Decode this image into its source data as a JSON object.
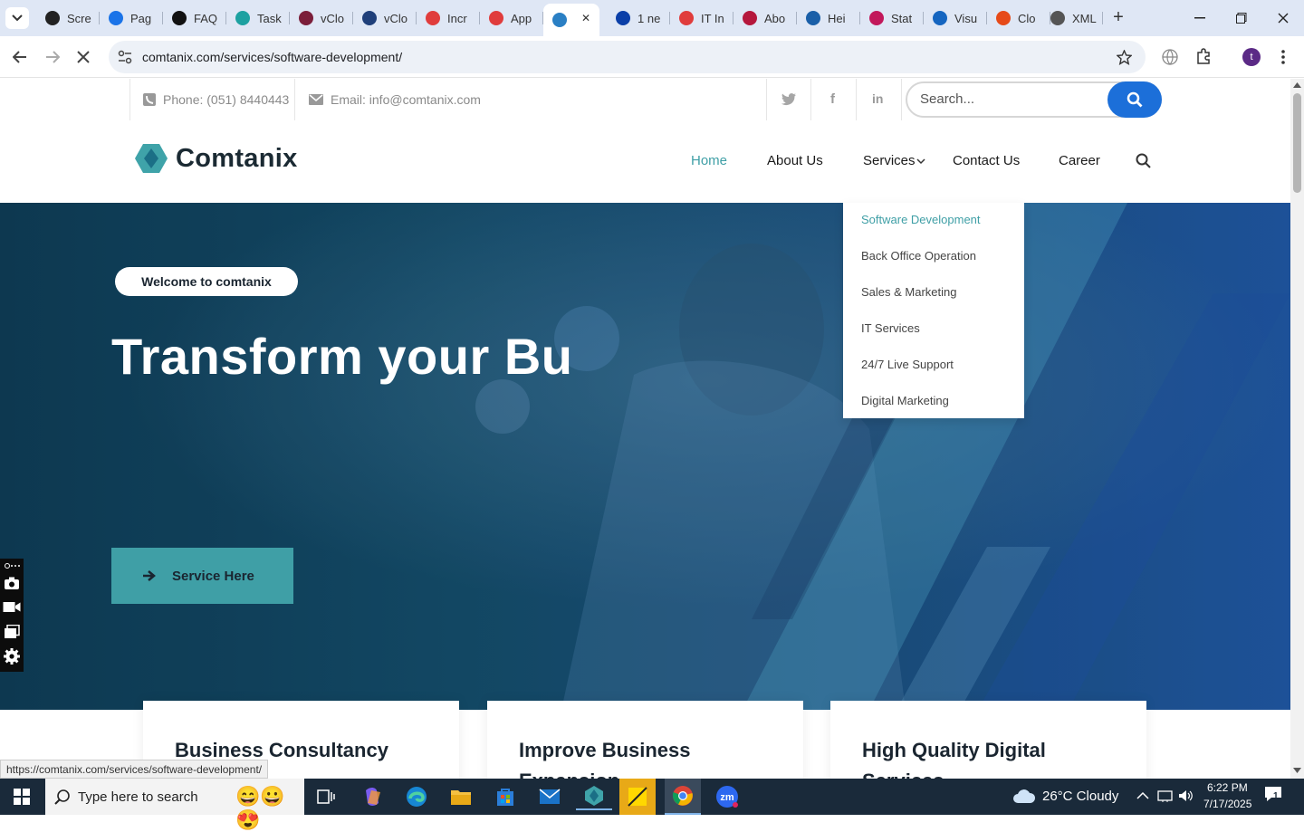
{
  "browser": {
    "tabs": [
      {
        "label": "Scre",
        "color": "#222222"
      },
      {
        "label": "Pag",
        "color": "#1a73e8"
      },
      {
        "label": "FAQ",
        "color": "#111111"
      },
      {
        "label": "Task",
        "color": "#1da1a1"
      },
      {
        "label": "vClo",
        "color": "#7b1e3a"
      },
      {
        "label": "vClo",
        "color": "#1f3f7a"
      },
      {
        "label": "Incr",
        "color": "#e03c3c"
      },
      {
        "label": "App",
        "color": "#e03c3c"
      },
      {
        "label": "",
        "color": "#2a7fc4"
      },
      {
        "label": "1 ne",
        "color": "#0b3fa8"
      },
      {
        "label": "IT In",
        "color": "#e03c3c"
      },
      {
        "label": "Abo",
        "color": "#b5173c"
      },
      {
        "label": "Hei",
        "color": "#1a5fa8"
      },
      {
        "label": "Stat",
        "color": "#c2185b"
      },
      {
        "label": "Visu",
        "color": "#1565c0"
      },
      {
        "label": "Clo",
        "color": "#e64a19"
      },
      {
        "label": "XML",
        "color": "#555555"
      }
    ],
    "url": "comtanix.com/services/software-development/",
    "status_url": "https://comtanix.com/services/software-development/"
  },
  "topbar": {
    "phone": "Phone: (051) 8440443",
    "email": "Email: info@comtanix.com",
    "search_placeholder": "Search..."
  },
  "header": {
    "logo_text": "Comtanix",
    "nav": [
      "Home",
      "About Us",
      "Services",
      "Contact Us",
      "Career"
    ]
  },
  "dropdown": {
    "items": [
      "Software Development",
      "Back Office Operation",
      "Sales & Marketing",
      "IT Services",
      "24/7 Live Support",
      "Digital Marketing"
    ]
  },
  "hero": {
    "badge": "Welcome to comtanix",
    "title": "Transform your Bu",
    "cta": "Service Here"
  },
  "cards": [
    {
      "title": "Business Consultancy"
    },
    {
      "title": "Improve Business Expansion"
    },
    {
      "title": "High Quality Digital Services"
    }
  ],
  "taskbar": {
    "search_placeholder": "Type here to search",
    "weather": "26°C  Cloudy",
    "time": "6:22 PM",
    "date": "7/17/2025",
    "notification_count": "1"
  },
  "colors": {
    "accent_teal": "#3f9fa6",
    "search_blue": "#1c6fd9",
    "hero_dark": "#0e3a52"
  }
}
